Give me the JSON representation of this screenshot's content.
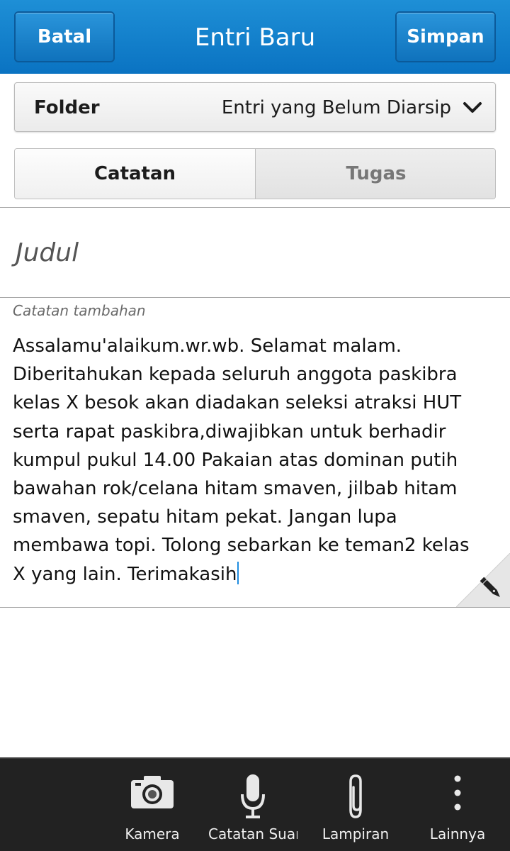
{
  "titlebar": {
    "cancel_label": "Batal",
    "title": "Entri Baru",
    "save_label": "Simpan"
  },
  "folder": {
    "label": "Folder",
    "value": "Entri yang Belum Diarsip"
  },
  "tabs": [
    {
      "label": "Catatan",
      "active": true
    },
    {
      "label": "Tugas",
      "active": false
    }
  ],
  "title_field": {
    "placeholder": "Judul"
  },
  "notes": {
    "label": "Catatan tambahan",
    "text": "Assalamu'alaikum.wr.wb. Selamat malam.\nDiberitahukan kepada seluruh anggota paskibra\nkelas X besok akan diadakan seleksi atraksi HUT\nserta rapat paskibra,diwajibkan untuk berhadir\nkumpul pukul 14.00 Pakaian atas dominan putih\nbawahan rok/celana hitam smaven, jilbab hitam\nsmaven, sepatu hitam pekat. Jangan lupa\nmembawa topi. Tolong sebarkan ke teman2 kelas\nX yang lain. Terimakasih"
  },
  "actions": [
    {
      "label": "Kamera",
      "icon": "camera-icon"
    },
    {
      "label": "Catatan Suara",
      "icon": "microphone-icon"
    },
    {
      "label": "Lampiran",
      "icon": "paperclip-icon"
    },
    {
      "label": "Lainnya",
      "icon": "more-vertical-icon"
    }
  ],
  "colors": {
    "titlebar": "#0a73c2",
    "cursor": "#1f8ce0",
    "actionbar": "#222222"
  }
}
